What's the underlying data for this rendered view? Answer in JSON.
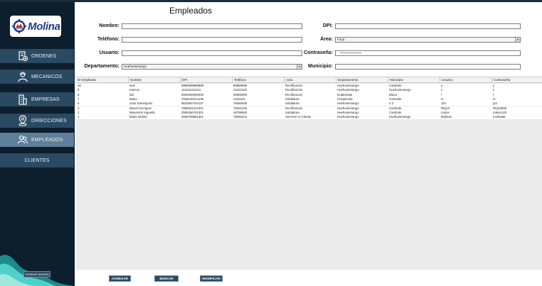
{
  "page": {
    "title": "Empleados"
  },
  "logo": {
    "brand": "Molina"
  },
  "sidebar": {
    "items": [
      {
        "label": "ORDENES",
        "icon": "orders-icon"
      },
      {
        "label": "MECANICOS",
        "icon": "mechanic-icon"
      },
      {
        "label": "EMPRESAS",
        "icon": "building-icon"
      },
      {
        "label": "DIRECCIONES",
        "icon": "location-icon"
      },
      {
        "label": "EMPLEADOS",
        "icon": "users-icon"
      },
      {
        "label": "CLIENTES",
        "icon": ""
      }
    ],
    "logout_label": "CERRAR SESIÓN"
  },
  "form": {
    "nombre_label": "Nombre:",
    "nombre_value": "",
    "dpi_label": "DPI:",
    "dpi_value": "",
    "telefono_label": "Teléfono:",
    "telefono_value": "",
    "area_label": "Área:",
    "area_value": "Forja",
    "usuario_label": "Usuario:",
    "usuario_value": "",
    "contrasena_label": "Contraseña:",
    "departamento_label": "Departamento:",
    "departamento_value": "Huehuetenango",
    "municipio_label": "Municipio:",
    "municipio_value": ""
  },
  "table": {
    "columns": [
      "ID Empleado",
      "Nombre",
      "DPI",
      "Teléfono",
      "Area",
      "Departamento",
      "Municipio",
      "Usuario",
      "Contraseña"
    ],
    "rows": [
      [
        "10",
        "Noe",
        "8888888888888",
        "88888888",
        "Rectificacion",
        "Huehuetenango",
        "Cambote",
        "y",
        "y"
      ],
      [
        "9",
        "marcos",
        "1111111111111",
        "22222222",
        "Rectificacion",
        "Huehuetenango",
        "Huehuetenango",
        "n",
        "n"
      ],
      [
        "8",
        "luis",
        "0000000000000",
        "00000000",
        "Rectificacion",
        "Guatemala",
        "Mixco",
        "l",
        "l"
      ],
      [
        "7",
        "Mario",
        "7845120212135",
        "11111111",
        "Soldadura",
        "Chiquimula",
        "Camotán",
        "m",
        "m"
      ],
      [
        "6",
        "Juan Dominguez",
        "9632587410147",
        "78456936",
        "Soldadura",
        "Huehuetenango",
        "Z 3",
        "J23",
        "j23"
      ],
      [
        "3",
        "Marvin Enriquez",
        "7896542131301",
        "78451236",
        "Rectificacion",
        "Huehuetenango",
        "Cambote",
        "RIQUI",
        "RIQUI665"
      ],
      [
        "2",
        "Marverick Arguetta",
        "2506456781301",
        "48798563",
        "Soldadura",
        "Huehuetenango",
        "Cambote",
        "marve",
        "marve123"
      ],
      [
        "1",
        "Mario Molina",
        "2590789561301",
        "78945612",
        "Atencion Al Cliente",
        "Huehuetenango",
        "Huehuetenango",
        "Molina1",
        "molina66"
      ]
    ]
  },
  "buttons": {
    "add": "AGREGAR",
    "search": "BUSCAR",
    "modify": "MODIFICAR"
  }
}
